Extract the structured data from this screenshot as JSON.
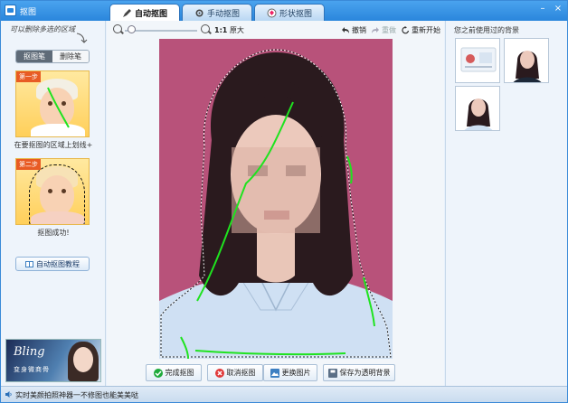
{
  "window": {
    "title": "抠图",
    "minimize": "–",
    "close": "×"
  },
  "tabs": [
    {
      "label": "自动抠图",
      "icon": "pen-icon",
      "active": true
    },
    {
      "label": "手动抠图",
      "icon": "gear-icon",
      "active": false
    },
    {
      "label": "形状抠图",
      "icon": "shape-icon",
      "active": false
    }
  ],
  "left_panel": {
    "hint": "可以删除多选的区域",
    "segment": {
      "left": "抠图笔",
      "right": "删除笔"
    },
    "steps": [
      {
        "tag": "第一步",
        "caption": "在要抠图的区域上划线+"
      },
      {
        "tag": "第二步",
        "caption": "抠图成功!"
      }
    ],
    "tutorial_button": "自动抠图教程",
    "ad": {
      "title": "Bling",
      "subtitle": "变身微商骨"
    }
  },
  "toolbar": {
    "zoom_original_bold": "1:1",
    "zoom_original": "原大",
    "undo": "撤销",
    "redo": "重做",
    "restart": "重新开始",
    "zoom_level": 0.05
  },
  "bottom_buttons": {
    "finish": "完成抠图",
    "cancel": "取消抠图",
    "replace": "更换图片",
    "save_transparent": "保存为透明背景"
  },
  "right_panel": {
    "title": "您之前使用过的背景"
  },
  "status_bar": {
    "text": "实时美颜拍照神器一不修图也能美美哒"
  },
  "colors": {
    "titlebar": "#2a86dc",
    "photo_bg": "#b8527a",
    "stroke_green": "#1fe31f",
    "shirt": "#cfe0f3"
  }
}
